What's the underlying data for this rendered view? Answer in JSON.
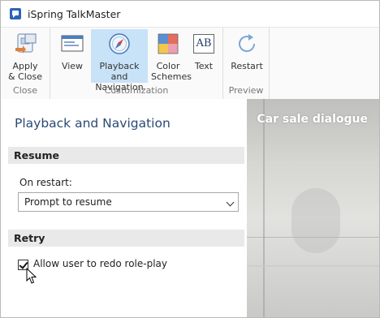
{
  "window": {
    "title": "iSpring TalkMaster"
  },
  "ribbon": {
    "groups": [
      {
        "label": "Close"
      },
      {
        "label": "Customization"
      },
      {
        "label": "Preview"
      }
    ],
    "buttons": {
      "apply_close": [
        "Apply",
        "& Close"
      ],
      "view": "View",
      "playback": [
        "Playback and",
        "Navigation"
      ],
      "color_schemes": [
        "Color",
        "Schemes"
      ],
      "text": "Text",
      "restart": "Restart"
    },
    "text_icon_glyph": "AB"
  },
  "panel": {
    "title": "Playback and Navigation",
    "resume": {
      "header": "Resume",
      "on_restart_label": "On restart:",
      "selected": "Prompt to resume"
    },
    "retry": {
      "header": "Retry",
      "checkbox_label": "Allow user to redo role-play",
      "checked": true
    }
  },
  "preview": {
    "title": "Car sale dialogue"
  },
  "colors": {
    "accent_selected": "#c8e2f7",
    "panel_title": "#2a4a75",
    "section_bg": "#e9e9e9"
  }
}
